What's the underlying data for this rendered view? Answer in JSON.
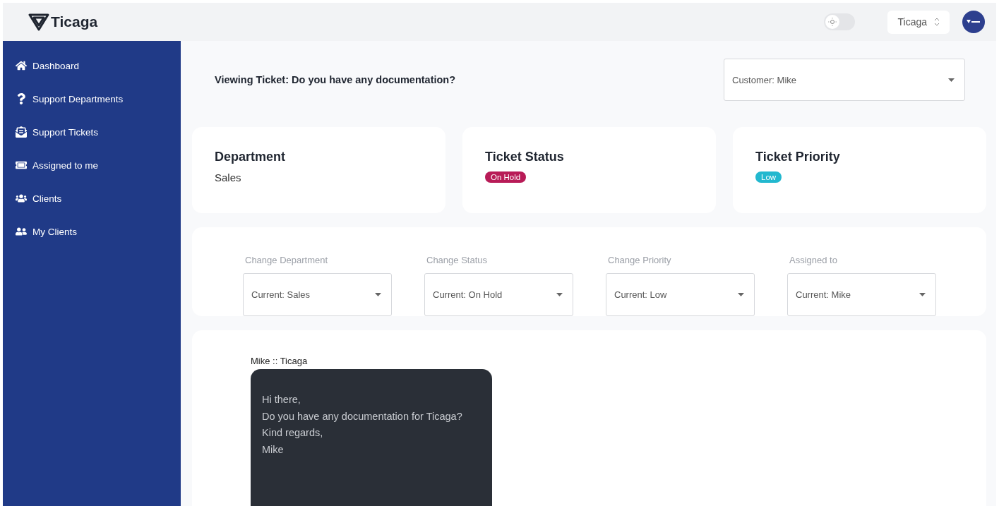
{
  "header": {
    "logo": "Ticaga",
    "dark_mode": {
      "on": false
    },
    "org_select": {
      "value": "Ticaga"
    }
  },
  "sidebar": {
    "items": [
      {
        "label": "Dashboard"
      },
      {
        "label": "Support Departments"
      },
      {
        "label": "Support Tickets"
      },
      {
        "label": "Assigned to me"
      },
      {
        "label": "Clients"
      },
      {
        "label": "My Clients"
      }
    ]
  },
  "ticket": {
    "title": "Viewing Ticket: Do you have any documentation?",
    "customer_select": {
      "value": "Customer: Mike"
    }
  },
  "summary": [
    {
      "heading": "Department",
      "kind": "text",
      "value": "Sales"
    },
    {
      "heading": "Ticket Status",
      "kind": "badge",
      "value": "On Hold",
      "color": "#b81b57"
    },
    {
      "heading": "Ticket Priority",
      "kind": "badge",
      "value": "Low",
      "color": "#22b8cf"
    }
  ],
  "controls": [
    {
      "label": "Change Department",
      "value": "Current: Sales"
    },
    {
      "label": "Change Status",
      "value": "Current: On Hold"
    },
    {
      "label": "Change Priority",
      "value": "Current: Low"
    },
    {
      "label": "Assigned to",
      "value": "Current: Mike"
    }
  ],
  "messages": [
    {
      "author": "Mike :: Ticaga",
      "lines": [
        "Hi there,",
        "Do you have any documentation for Ticaga?",
        "Kind regards,",
        "Mike"
      ]
    }
  ]
}
